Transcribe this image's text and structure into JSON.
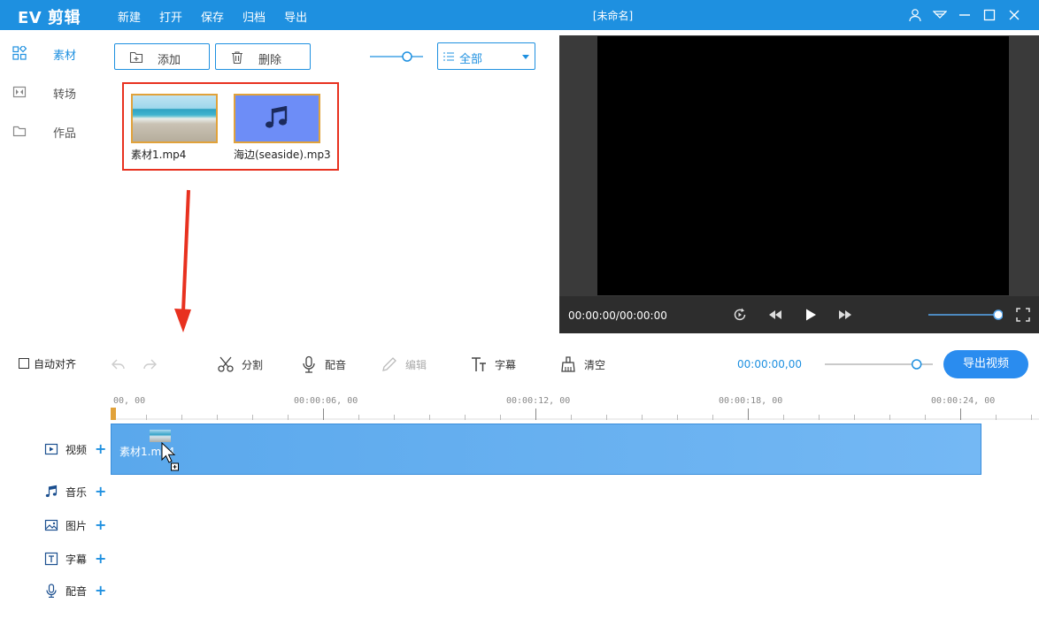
{
  "app": {
    "logo": "EV 剪辑",
    "doc_title": "[未命名]"
  },
  "menu": [
    "新建",
    "打开",
    "保存",
    "归档",
    "导出"
  ],
  "window_controls": [
    "user-icon",
    "skin-icon",
    "minimize-icon",
    "maximize-icon",
    "close-icon"
  ],
  "sidebar": {
    "items": [
      {
        "label": "素材",
        "icon": "grid-icon",
        "active": true
      },
      {
        "label": "转场",
        "icon": "transition-icon",
        "active": false
      },
      {
        "label": "作品",
        "icon": "folder-icon",
        "active": false
      }
    ]
  },
  "media_toolbar": {
    "add_label": "添加",
    "delete_label": "删除",
    "thumb_zoom_fraction": 0.7,
    "filter_value": "全部"
  },
  "media": [
    {
      "name": "素材1.mp4",
      "kind": "video"
    },
    {
      "name": "海边(seaside).mp3",
      "kind": "audio"
    }
  ],
  "preview": {
    "time": "00:00:00/00:00:00",
    "volume_fraction": 0.98
  },
  "edit_toolbar": {
    "auto_align_label": "自动对齐",
    "auto_align_checked": false,
    "tools": [
      {
        "label": "分割",
        "icon": "scissors-icon",
        "enabled": true
      },
      {
        "label": "配音",
        "icon": "microphone-icon",
        "enabled": true
      },
      {
        "label": "编辑",
        "icon": "pencil-icon",
        "enabled": false
      },
      {
        "label": "字幕",
        "icon": "text-icon",
        "enabled": true
      },
      {
        "label": "清空",
        "icon": "brush-icon",
        "enabled": true
      }
    ],
    "current_time": "00:00:00,00",
    "timeline_zoom_fraction": 0.85,
    "export_label": "导出视频"
  },
  "timeline": {
    "ruler_labels": [
      "00, 00",
      "00:00:06, 00",
      "00:00:12, 00",
      "00:00:18, 00",
      "00:00:24, 00"
    ],
    "tracks": [
      {
        "label": "视频",
        "icon": "video-icon"
      },
      {
        "label": "音乐",
        "icon": "music-icon"
      },
      {
        "label": "图片",
        "icon": "image-icon"
      },
      {
        "label": "字幕",
        "icon": "text-box-icon"
      },
      {
        "label": "配音",
        "icon": "microphone-icon"
      }
    ],
    "clip_label": "素材1.mp4"
  },
  "colors": {
    "accent": "#1e90e0",
    "highlight_border": "#e8311f",
    "clip": "#5aa8ec"
  }
}
